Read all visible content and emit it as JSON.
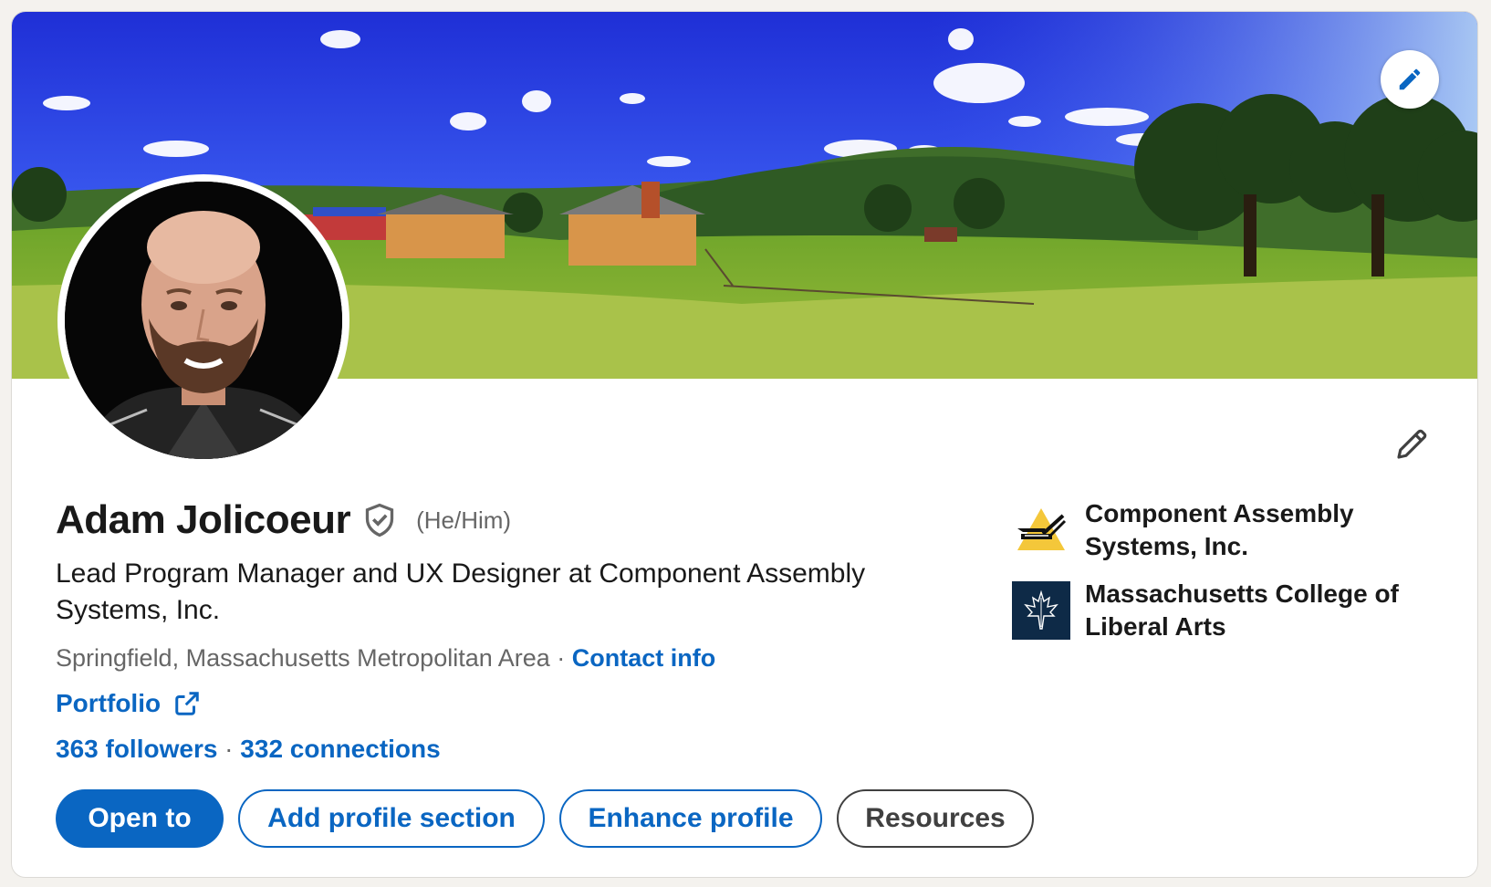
{
  "profile": {
    "name": "Adam Jolicoeur",
    "pronouns": "(He/Him)",
    "headline": "Lead Program Manager and UX Designer at Component Assembly Systems, Inc.",
    "location": "Springfield, Massachusetts Metropolitan Area",
    "location_separator": " · ",
    "contact_info_label": "Contact info",
    "portfolio_label": "Portfolio",
    "followers": "363 followers",
    "stats_separator": " · ",
    "connections": "332 connections"
  },
  "buttons": {
    "open_to": "Open to",
    "add_profile_section": "Add profile section",
    "enhance_profile": "Enhance profile",
    "resources": "Resources"
  },
  "organizations": [
    {
      "name": "Component Assembly Systems, Inc.",
      "logo": "component-assembly-logo"
    },
    {
      "name": "Massachusetts College of Liberal Arts",
      "logo": "mcla-maple-leaf-logo"
    }
  ],
  "icons": {
    "banner_edit": "pencil-icon",
    "intro_edit": "pencil-icon",
    "verified": "shield-check-icon",
    "external_link": "external-link-icon"
  },
  "colors": {
    "link_blue": "#0a66c2",
    "text_primary": "#191919",
    "text_secondary": "#666666",
    "mcla_navy": "#0e2a47",
    "cas_yellow": "#f4c73a"
  }
}
